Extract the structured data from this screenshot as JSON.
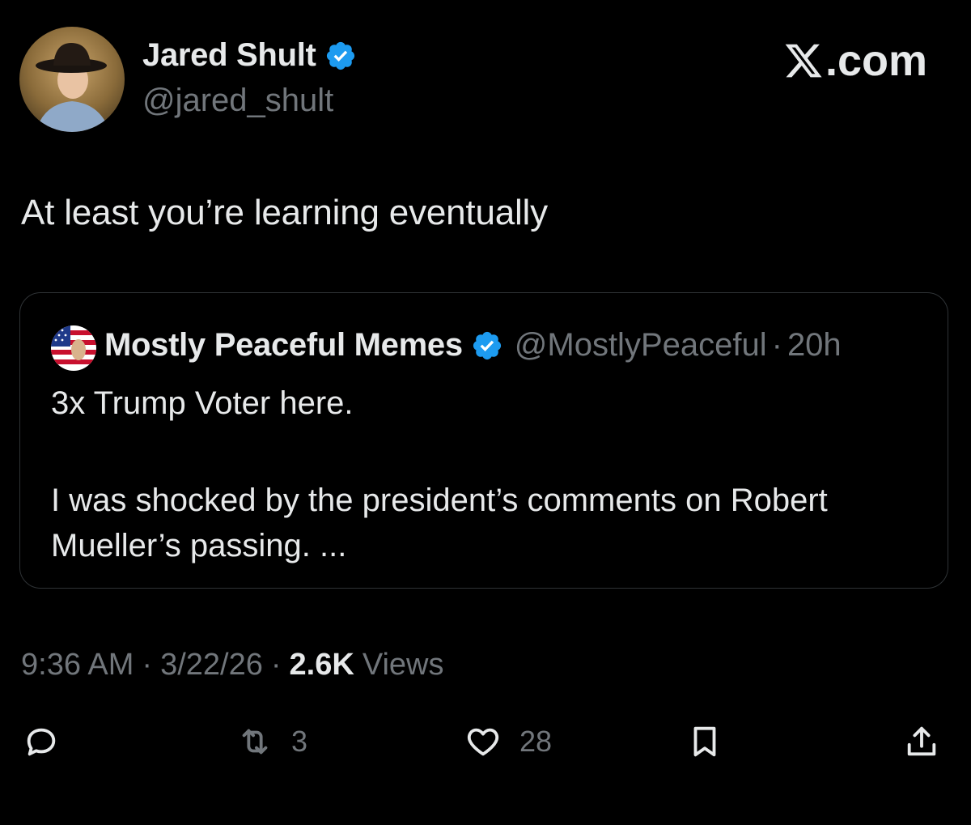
{
  "site_logo_text": ".com",
  "author": {
    "display_name": "Jared Shult",
    "handle": "@jared_shult",
    "verified": true
  },
  "tweet": {
    "text": "At least you’re learning eventually"
  },
  "quoted_tweet": {
    "display_name": "Mostly Peaceful Memes",
    "handle": "@MostlyPeaceful",
    "separator": "·",
    "time_ago": "20h",
    "verified": true,
    "line1": "3x Trump Voter here.",
    "line2": "I was shocked by the president’s comments on Robert Mueller’s passing. ..."
  },
  "meta": {
    "time": "9:36 AM",
    "date": "3/22/26",
    "separator": "·",
    "views_count": "2.6K",
    "views_label": "Views"
  },
  "actions": {
    "reply_icon": "reply-bubble-icon",
    "repost_count": "3",
    "like_count": "28",
    "bookmark_icon": "bookmark-icon",
    "share_icon": "share-icon"
  },
  "colors": {
    "background": "#000000",
    "primary_text": "#e7e9ea",
    "secondary_text": "#71767b",
    "verified_blue": "#1d9bf0",
    "card_border": "#2f3336"
  }
}
